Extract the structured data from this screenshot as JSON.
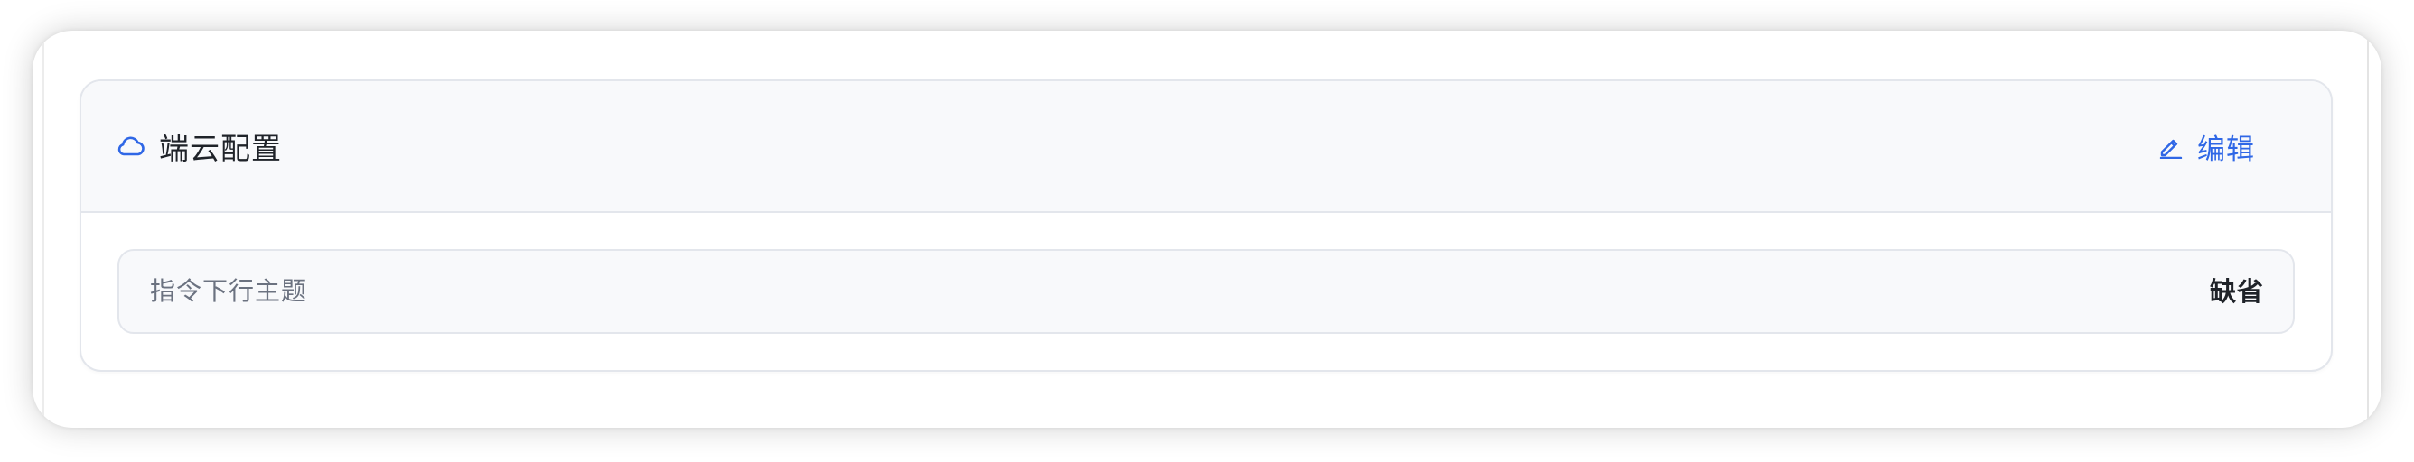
{
  "section": {
    "title": "端云配置",
    "title_icon": "cloud-icon",
    "edit_label": "编辑",
    "edit_icon": "pen-icon"
  },
  "config_rows": [
    {
      "label": "指令下行主题",
      "value": "缺省"
    }
  ],
  "colors": {
    "accent": "#2f67e6",
    "title_text": "#1f2329",
    "muted_text": "#6b7280",
    "header_bg": "#f8f9fb",
    "border": "#e3e6ec"
  }
}
